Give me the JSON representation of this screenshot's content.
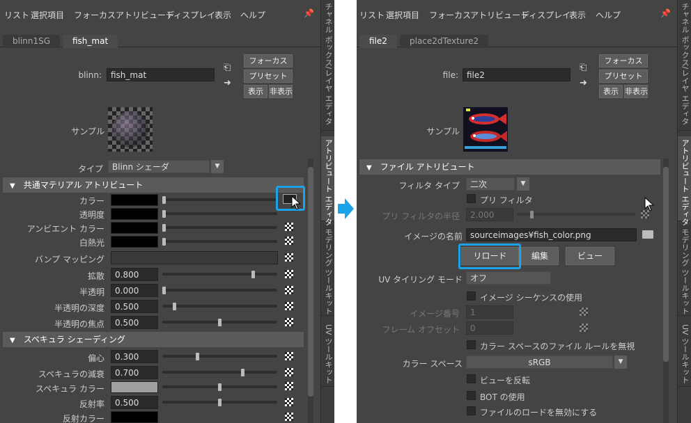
{
  "left": {
    "menu": [
      "リスト",
      "選択項目",
      "フォーカス",
      "アトリビュート",
      "ディスプレイ",
      "表示",
      "ヘルプ"
    ],
    "tabs": [
      "blinn1SG",
      "fish_mat"
    ],
    "node_label": "blinn:",
    "node_name": "fish_mat",
    "buttons": {
      "focus": "フォーカス",
      "preset": "プリセット",
      "show": "表示",
      "hide": "非表示"
    },
    "sample_label": "サンプル",
    "type_label": "タイプ",
    "type_value": "Blinn シェーダ",
    "section_common": "共通マテリアル アトリビュート",
    "color_label": "カラー",
    "transparency_label": "透明度",
    "ambient_label": "アンビエント カラー",
    "incandescence_label": "白熱光",
    "bump_label": "バンプ マッピング",
    "diffuse_label": "拡散",
    "diffuse_value": "0.800",
    "translucence_label": "半透明",
    "translucence_value": "0.000",
    "trans_depth_label": "半透明の深度",
    "trans_depth_value": "0.500",
    "trans_focus_label": "半透明の焦点",
    "trans_focus_value": "0.500",
    "section_specular": "スペキュラ シェーディング",
    "eccentricity_label": "偏心",
    "eccentricity_value": "0.300",
    "spec_rolloff_label": "スペキュラの減衰",
    "spec_rolloff_value": "0.700",
    "spec_color_label": "スペキュラ カラー",
    "reflectivity_label": "反射率",
    "reflectivity_value": "0.500",
    "reflected_color_label": "反射カラー",
    "side_tabs": [
      "チャネル ボックス/レイヤ エディタ",
      "アトリビュート エディタ",
      "モデリング ツールキット",
      "UV ツールキット"
    ]
  },
  "right": {
    "menu": [
      "リスト",
      "選択項目",
      "フォーカス",
      "アトリビュート",
      "ディスプレイ",
      "表示",
      "ヘルプ"
    ],
    "tabs": [
      "file2",
      "place2dTexture2"
    ],
    "node_label": "file:",
    "node_name": "file2",
    "buttons": {
      "focus": "フォーカス",
      "preset": "プリセット",
      "show": "表示",
      "hide": "非表示"
    },
    "sample_label": "サンプル",
    "section_file": "ファイル アトリビュート",
    "filter_type_label": "フィルタ タイプ",
    "filter_type_value": "二次",
    "pre_filter_label": "プリ フィルタ",
    "pre_filter_radius_label": "プリ フィルタの半径",
    "pre_filter_radius_value": "2.000",
    "image_name_label": "イメージの名前",
    "image_name_value": "sourceimages¥fish_color.png",
    "reload_button": "リロード",
    "edit_button": "編集",
    "view_button": "ビュー",
    "uv_tiling_label": "UV タイリング モード",
    "uv_tiling_value": "オフ",
    "use_sequence_label": "イメージ シーケンスの使用",
    "image_number_label": "イメージ番号",
    "image_number_value": "1",
    "frame_offset_label": "フレーム オフセット",
    "frame_offset_value": "0",
    "ignore_cs_label": "カラー スペースのファイル ルールを無視",
    "color_space_label": "カラー スペース",
    "color_space_value": "sRGB",
    "invert_view_label": "ビューを反転",
    "use_bot_label": "BOT の使用",
    "disable_load_label": "ファイルのロードを無効にする",
    "side_tabs": [
      "チャネル ボックス/レイヤ エディタ",
      "アトリビュート エディタ",
      "モデリング ツールキット",
      "UV ツールキット"
    ]
  },
  "colors": {
    "highlight": "#1aa3e8",
    "panel": "#444444",
    "field": "#2b2b2b"
  }
}
